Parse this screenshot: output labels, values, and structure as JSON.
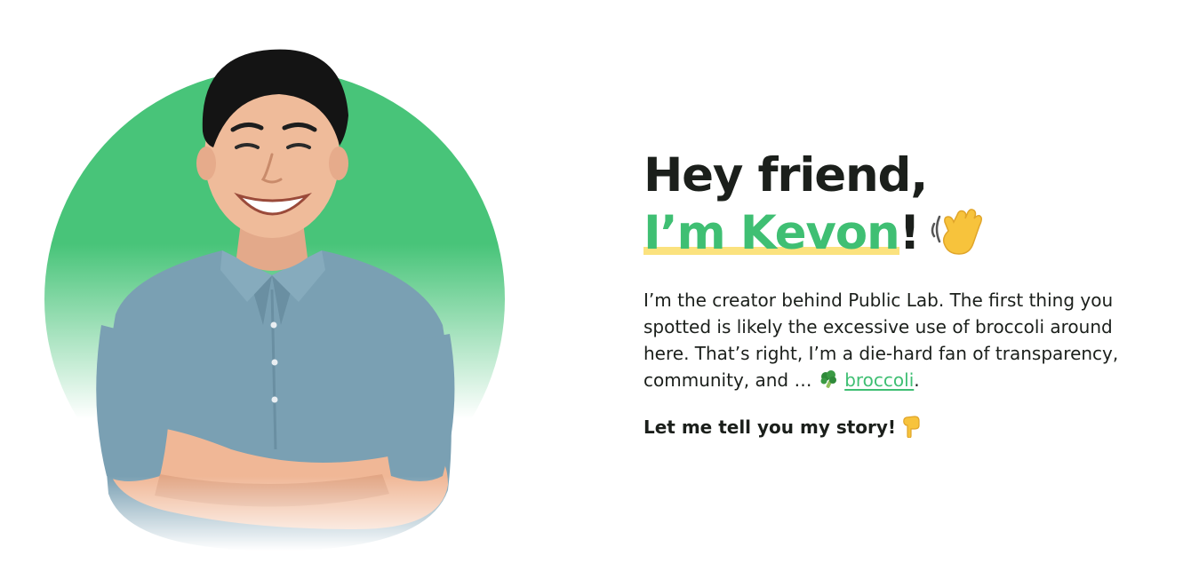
{
  "hero": {
    "headline_line1": "Hey friend,",
    "headline_name": "I’m Kevon",
    "headline_exclaim": "!",
    "wave_icon": "waving-hand-icon"
  },
  "bio": {
    "text_before_link": "I’m the creator behind Public Lab. The first thing you spotted is likely the excessive use of broccoli around here. That’s right, I’m a die-hard fan of transparency, community, and … ",
    "link_icon": "broccoli-icon",
    "link_label": "broccoli",
    "text_after_link": "."
  },
  "cta": {
    "label": "Let me tell you my story!",
    "icon": "pointing-down-icon"
  },
  "colors": {
    "accent": "#3fbf73",
    "circle": "#48c479",
    "highlight": "#fbe27e",
    "text": "#1b1f1b",
    "shirt": "#7aa0b3"
  }
}
